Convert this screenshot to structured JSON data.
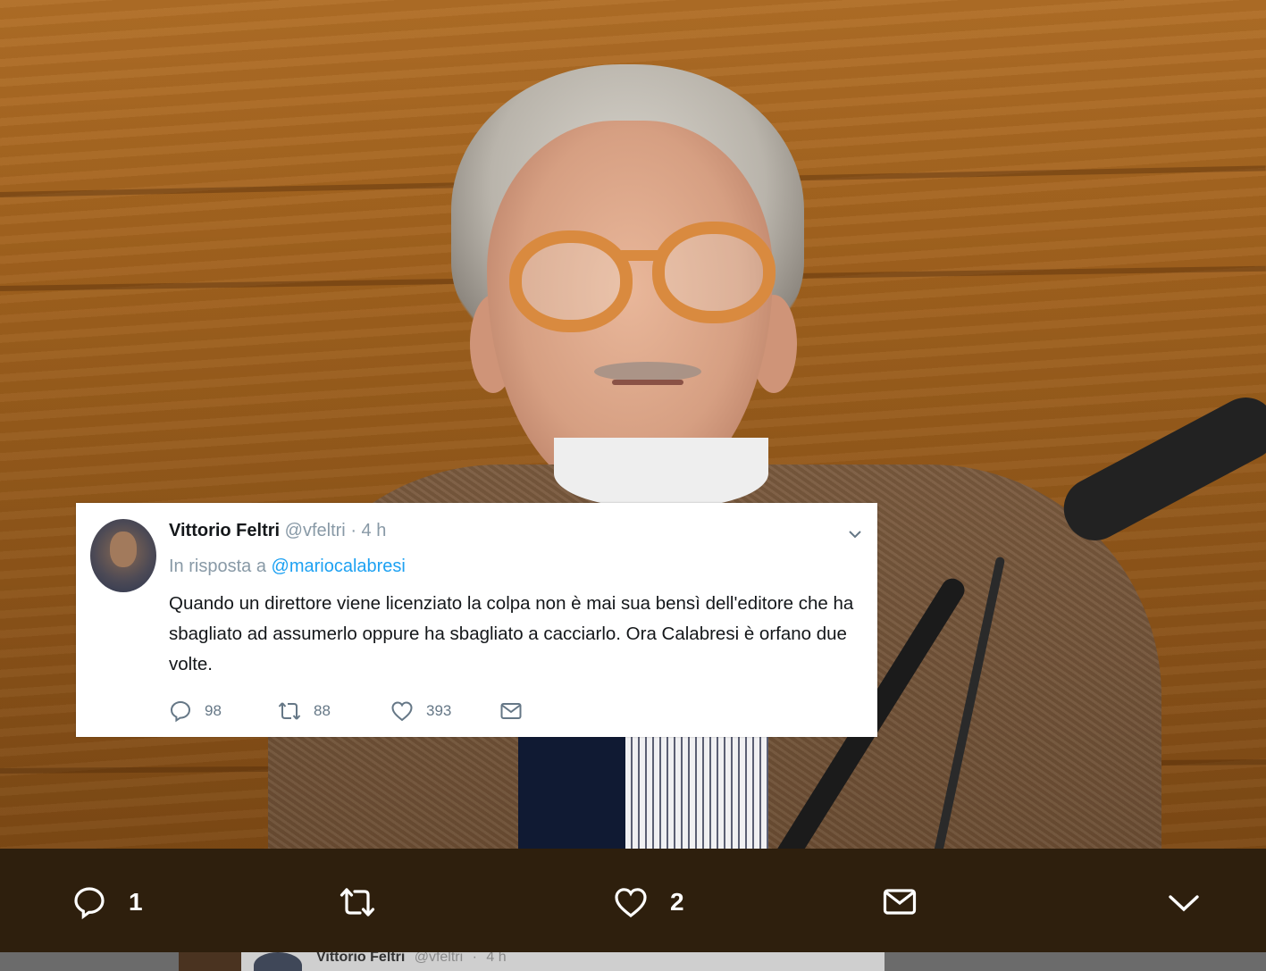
{
  "tweet": {
    "name": "Vittorio Feltri",
    "handle": "@vfeltri",
    "separator": "·",
    "time": "4 h",
    "reply_prefix": "In risposta a",
    "reply_mention": "@mariocalabresi",
    "text": "Quando un direttore viene  licenziato la colpa non è mai sua bensì dell'editore che ha sbagliato ad assumerlo oppure ha sbagliato a cacciarlo. Ora Calabresi è orfano due volte.",
    "reply_count": "98",
    "retweet_count": "88",
    "like_count": "393",
    "icons": [
      "reply-icon",
      "retweet-icon",
      "heart-icon",
      "mail-icon",
      "chevron-down-icon"
    ]
  },
  "action_bar": {
    "reply_count": "1",
    "like_count": "2",
    "icons": [
      "reply-icon",
      "retweet-icon",
      "heart-icon",
      "mail-icon",
      "chevron-down-icon"
    ],
    "text_color": "#ffffff",
    "background": "#2e1f0d"
  },
  "next_tweet_peek": {
    "name": "Vittorio Feltri",
    "handle": "@vfeltri",
    "separator": "·",
    "time": "4 h"
  },
  "colors": {
    "link": "#1da1f2",
    "muted": "#8899a6"
  }
}
